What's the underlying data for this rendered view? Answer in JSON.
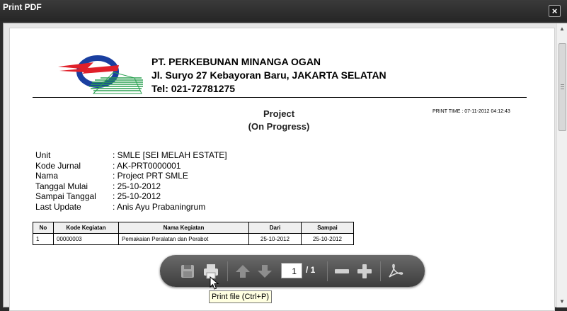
{
  "window": {
    "title": "Print PDF",
    "close_symbol": "×"
  },
  "company": {
    "name": "PT. PERKEBUNAN MINANGA OGAN",
    "address": "Jl. Suryo 27 Kebayoran Baru, JAKARTA SELATAN",
    "phone": "Tel: 021-72781275"
  },
  "report": {
    "title_line1": "Project",
    "title_line2": "(On Progress)",
    "print_time": "PRINT TIME : 07-11-2012 04:12:43"
  },
  "info": [
    {
      "label": "Unit",
      "value": ": SMLE [SEI MELAH ESTATE]"
    },
    {
      "label": "Kode Jurnal",
      "value": ": AK-PRT0000001"
    },
    {
      "label": "Nama",
      "value": ": Project PRT SMLE"
    },
    {
      "label": "Tanggal Mulai",
      "value": ": 25-10-2012"
    },
    {
      "label": "Sampai Tanggal",
      "value": ": 25-10-2012"
    },
    {
      "label": "Last Update",
      "value": ": Anis Ayu Prabaningrum"
    }
  ],
  "table": {
    "headers": [
      "No",
      "Kode Kegiatan",
      "Nama Kegiatan",
      "Dari",
      "Sampai"
    ],
    "rows": [
      [
        "1",
        "00000003",
        "Pemakaian Peralatan dan Perabot",
        "25-10-2012",
        "25-10-2012"
      ]
    ]
  },
  "toolbar": {
    "current_page": "1",
    "total_pages": "/ 1",
    "icons": [
      "save-icon",
      "print-icon",
      "arrow-up-icon",
      "arrow-down-icon",
      "zoom-out-icon",
      "zoom-in-icon",
      "adobe-acrobat-icon"
    ]
  },
  "tooltip": {
    "text": "Print file (Ctrl+P)"
  },
  "colors": {
    "titlebar": "#2b2b2b",
    "toolbar": "#4a4a4a",
    "logo_red": "#e0202a",
    "logo_blue": "#1a3fa0",
    "logo_green": "#2aa050",
    "tooltip_bg": "#ffffe1"
  }
}
